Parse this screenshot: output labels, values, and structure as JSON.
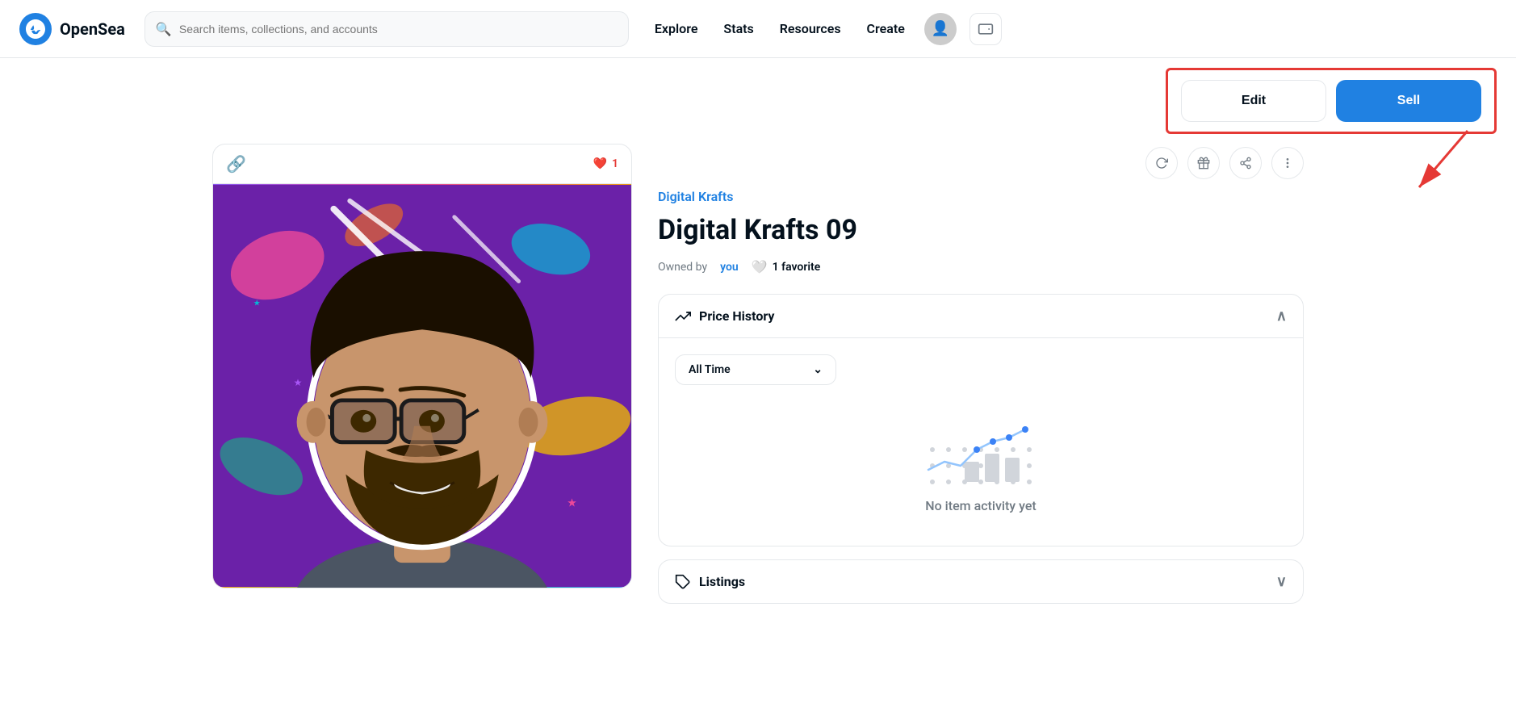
{
  "brand": {
    "name": "OpenSea",
    "logo_alt": "OpenSea logo"
  },
  "navbar": {
    "search_placeholder": "Search items, collections, and accounts",
    "nav_links": [
      {
        "id": "explore",
        "label": "Explore"
      },
      {
        "id": "stats",
        "label": "Stats"
      },
      {
        "id": "resources",
        "label": "Resources"
      },
      {
        "id": "create",
        "label": "Create"
      }
    ]
  },
  "action_bar": {
    "edit_label": "Edit",
    "sell_label": "Sell"
  },
  "nft": {
    "collection_name": "Digital Krafts",
    "title": "Digital Krafts 09",
    "owned_by_prefix": "Owned by",
    "owner_label": "you",
    "favorites_count": "1 favorite",
    "like_count": "1"
  },
  "price_history": {
    "section_title": "Price History",
    "time_filter_label": "All Time",
    "no_activity_text": "No item activity yet"
  },
  "bottom_section": {
    "section_title": "Listings"
  },
  "icons": {
    "search": "🔍",
    "refresh": "↻",
    "gift": "🎁",
    "share": "↗",
    "more": "⋮",
    "chain": "🔗",
    "heart": "♥",
    "heart_filled": "🤍",
    "trending": "📈",
    "chevron_down": "⌄",
    "chevron_up": "^",
    "tag": "🏷"
  },
  "colors": {
    "primary": "#2081e2",
    "danger": "#e53935",
    "text_muted": "#707a83",
    "text_dark": "#04111d",
    "border": "#e5e8eb"
  }
}
